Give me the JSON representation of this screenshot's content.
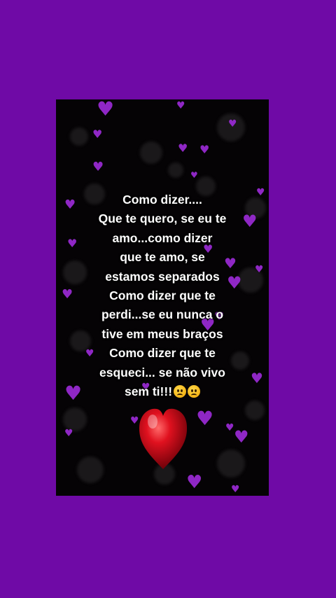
{
  "poem": {
    "lines": [
      "Como dizer....",
      "Que te quero, se eu te",
      "amo...como dizer",
      "que te amo, se",
      "estamos separados",
      "Como dizer que te",
      "perdi...se eu nunca o",
      "tive em meus braços",
      "Como dizer que te",
      "esqueci... se não vivo",
      "sem ti!!!"
    ],
    "emojis": [
      "frowning-face-emoji",
      "crying-face-emoji"
    ]
  },
  "colors": {
    "background": "#6f0aa6",
    "card": "#050305",
    "small_hearts": "#9b2bd6",
    "big_heart": "#e0111f",
    "text": "#ffffff"
  }
}
